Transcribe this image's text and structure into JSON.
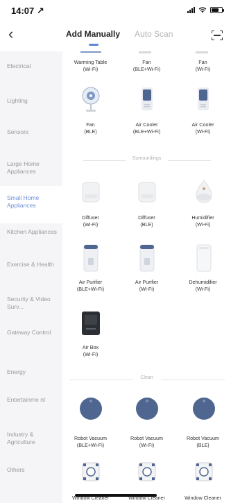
{
  "status": {
    "time": "14:07 ↗"
  },
  "header": {
    "back": "‹",
    "tab_active": "Add Manually",
    "tab_inactive": "Auto Scan"
  },
  "sidebar": {
    "items": [
      {
        "label": "Electrical"
      },
      {
        "label": "Lighting"
      },
      {
        "label": "Sensors"
      },
      {
        "label": "Large Home Appliances"
      },
      {
        "label": "Small Home Appliances"
      },
      {
        "label": "Kitchen Appliances"
      },
      {
        "label": "Exercise & Health"
      },
      {
        "label": "Security & Video Surv..."
      },
      {
        "label": "Gateway Control"
      },
      {
        "label": "Energy"
      },
      {
        "label": "Entertainme nt"
      },
      {
        "label": "Industry & Agriculture"
      },
      {
        "label": "Others"
      }
    ]
  },
  "devices": {
    "top_row": [
      {
        "name": "Warming Table",
        "proto": "(Wi-Fi)"
      },
      {
        "name": "Fan",
        "proto": "(BLE+Wi-Fi)"
      },
      {
        "name": "Fan",
        "proto": "(Wi-Fi)"
      }
    ],
    "row2": [
      {
        "name": "Fan",
        "proto": "(BLE)"
      },
      {
        "name": "Air Cooler",
        "proto": "(BLE+Wi-Fi)"
      },
      {
        "name": "Air Cooler",
        "proto": "(Wi-Fi)"
      }
    ],
    "surroundings_label": "Surroundings",
    "surroundings": [
      {
        "name": "Diffuser",
        "proto": "(Wi-Fi)"
      },
      {
        "name": "Diffuser",
        "proto": "(BLE)"
      },
      {
        "name": "Humidifier",
        "proto": "(Wi-Fi)"
      },
      {
        "name": "Air Purifier",
        "proto": "(BLE+Wi-Fi)"
      },
      {
        "name": "Air Purifier",
        "proto": "(Wi-Fi)"
      },
      {
        "name": "Dehumidifier",
        "proto": "(Wi-Fi)"
      },
      {
        "name": "Air Box",
        "proto": "(Wi-Fi)"
      }
    ],
    "clean_label": "Clean",
    "clean": [
      {
        "name": "Robot Vacuum",
        "proto": "(BLE+Wi-Fi)"
      },
      {
        "name": "Robot Vacuum",
        "proto": "(Wi-Fi)"
      },
      {
        "name": "Robot Vacuum",
        "proto": "(BLE)"
      }
    ],
    "bottom_row": [
      {
        "name": "Window Cleaner"
      },
      {
        "name": "Window Cleaner"
      },
      {
        "name": "Window Cleaner"
      }
    ]
  },
  "colors": {
    "accent": "#5a87d6",
    "sidebar_bg": "#f5f5f7",
    "vacuum": "#4f6690"
  }
}
